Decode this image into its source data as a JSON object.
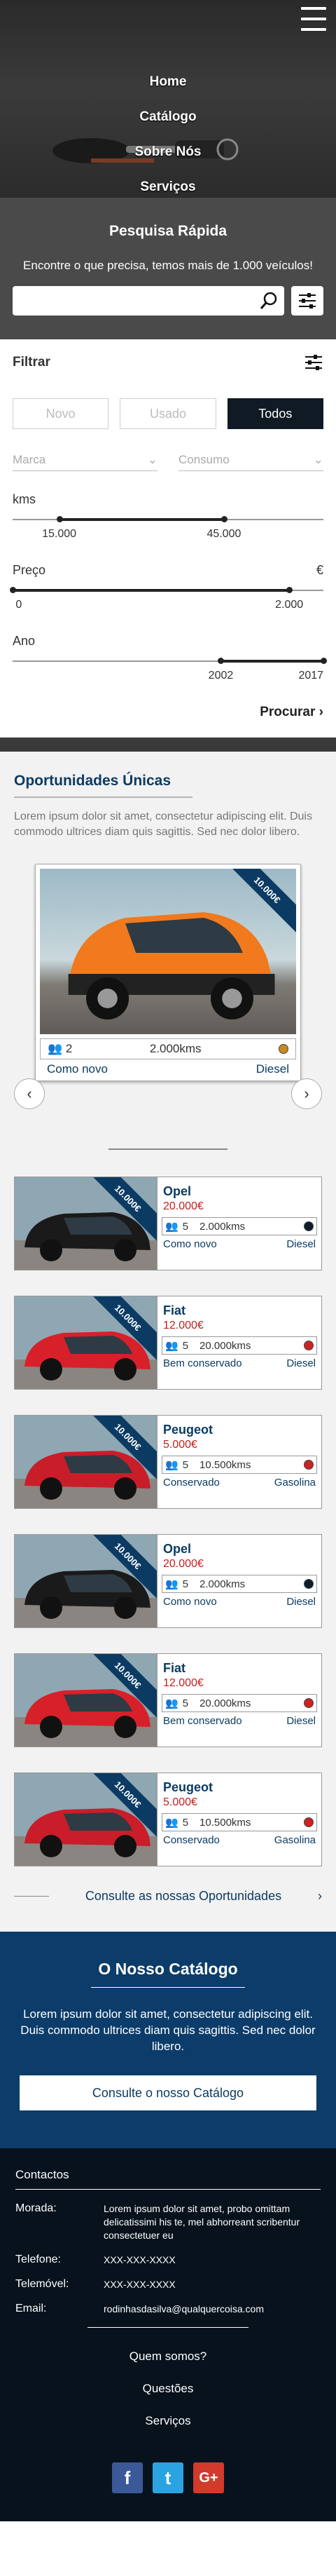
{
  "nav": {
    "items": [
      "Home",
      "Catálogo",
      "Sobre Nós",
      "Serviços"
    ]
  },
  "quick_search": {
    "title": "Pesquisa Rápida",
    "text": "Encontre o que precisa, temos mais de 1.000 veículos!",
    "placeholder": ""
  },
  "filter": {
    "title": "Filtrar",
    "toggles": [
      "Novo",
      "Usado",
      "Todos"
    ],
    "active_toggle": "Todos",
    "brand_placeholder": "Marca",
    "fuel_placeholder": "Consumo",
    "kms": {
      "label": "kms",
      "min_label": "15.000",
      "max_label": "45.000",
      "min_frac": 0.15,
      "max_frac": 0.68
    },
    "preco": {
      "label": "Preço",
      "unit": "€",
      "min_label": "0",
      "max_label": "2.000",
      "min_frac": 0.0,
      "max_frac": 0.89
    },
    "ano": {
      "label": "Ano",
      "min_label": "2002",
      "max_label": "2017",
      "min_frac": 0.67,
      "max_frac": 1.0
    },
    "search_label": "Procurar"
  },
  "opportunities": {
    "title": "Oportunidades Únicas",
    "lead": "Lorem ipsum dolor sit amet, consectetur adipiscing elit. Duis commodo ultrices diam quis sagittis. Sed nec dolor libero.",
    "featured": {
      "ribbon": "10.000€",
      "owners": "2",
      "kms": "2.000kms",
      "condition": "Como novo",
      "fuel": "Diesel",
      "dot_color": "#c98a1f"
    },
    "cards": [
      {
        "name": "Opel",
        "price": "20.000€",
        "owners": "5",
        "kms": "2.000kms",
        "condition": "Como novo",
        "fuel": "Diesel",
        "dot": "#0d1d2c",
        "car": "#1a1a1a",
        "ribbon": "10.000€"
      },
      {
        "name": "Fiat",
        "price": "12.000€",
        "owners": "5",
        "kms": "20.000kms",
        "condition": "Bem conservado",
        "fuel": "Diesel",
        "dot": "#cc2222",
        "car": "#d8202a",
        "ribbon": "10.000€"
      },
      {
        "name": "Peugeot",
        "price": "5.000€",
        "owners": "5",
        "kms": "10.500kms",
        "condition": "Conservado",
        "fuel": "Gasolina",
        "dot": "#cc2222",
        "car": "#c91d2a",
        "ribbon": "10.000€"
      },
      {
        "name": "Opel",
        "price": "20.000€",
        "owners": "5",
        "kms": "2.000kms",
        "condition": "Como novo",
        "fuel": "Diesel",
        "dot": "#0d1d2c",
        "car": "#1a1a1a",
        "ribbon": "10.000€"
      },
      {
        "name": "Fiat",
        "price": "12.000€",
        "owners": "5",
        "kms": "20.000kms",
        "condition": "Bem conservado",
        "fuel": "Diesel",
        "dot": "#cc2222",
        "car": "#d8202a",
        "ribbon": "10.000€"
      },
      {
        "name": "Peugeot",
        "price": "5.000€",
        "owners": "5",
        "kms": "10.500kms",
        "condition": "Conservado",
        "fuel": "Gasolina",
        "dot": "#cc2222",
        "car": "#c91d2a",
        "ribbon": "10.000€"
      }
    ],
    "link_label": "Consulte as nossas Oportunidades"
  },
  "catalogue": {
    "title": "O Nosso Catálogo",
    "text": "Lorem ipsum dolor sit amet, consectetur adipiscing elit. Duis commodo ultrices diam quis sagittis. Sed nec dolor libero.",
    "button": "Consulte o nosso Catálogo"
  },
  "footer": {
    "title": "Contactos",
    "morada_label": "Morada:",
    "morada": "Lorem ipsum dolor sit amet, probo omittam delicatissimi his te, mel abhorreant scribentur consectetuer eu",
    "telefone_label": "Telefone:",
    "telefone": "XXX-XXX-XXXX",
    "telemovel_label": "Telemóvel:",
    "telemovel": "XXX-XXX-XXXX",
    "email_label": "Email:",
    "email": "rodinhasdasilva@qualquercoisa.com",
    "links": [
      "Quem somos?",
      "Questões",
      "Serviços"
    ]
  },
  "colors": {
    "brand": "#0b3b63",
    "price": "#c0201f",
    "dark": "#07121c"
  },
  "icons": {
    "menu": "hamburger-icon",
    "search": "search-icon",
    "filter": "sliders-icon",
    "person": "people-icon",
    "social": [
      "facebook-icon",
      "twitter-icon",
      "google-plus-icon"
    ]
  }
}
